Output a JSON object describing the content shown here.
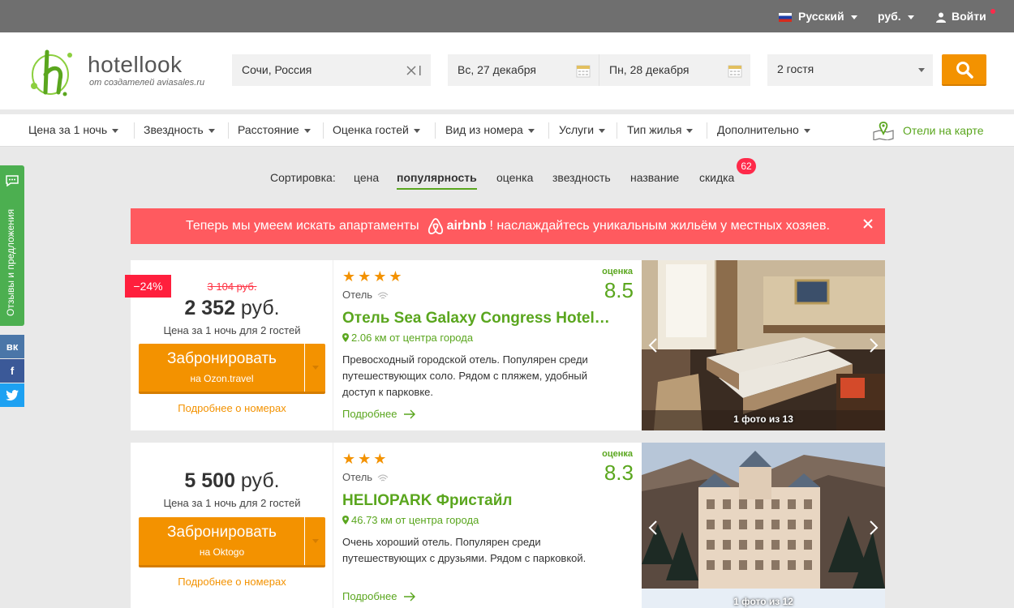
{
  "topbar": {
    "language": "Русский",
    "currency": "руб.",
    "login": "Войти"
  },
  "header": {
    "logo_name": "hotellook",
    "logo_sub": "от создателей aviasales.ru",
    "destination": "Сочи, Россия",
    "checkin": "Вс, 27 декабря",
    "checkout": "Пн, 28 декабря",
    "guests": "2 гостя"
  },
  "filters": [
    "Цена за 1 ночь",
    "Звездность",
    "Расстояние",
    "Оценка гостей",
    "Вид из номера",
    "Услуги",
    "Тип жилья",
    "Дополнительно"
  ],
  "map_link": "Отели на карте",
  "feedback_tab": "Отзывы и предложения",
  "social": [
    "вк",
    "f",
    "tw"
  ],
  "sort": {
    "label": "Сортировка:",
    "options": [
      "цена",
      "популярность",
      "оценка",
      "звездность",
      "название",
      "скидка"
    ],
    "active": "популярность",
    "discount_badge": "62"
  },
  "banner": {
    "text_before": "Теперь мы умеем искать апартаменты",
    "brand": "airbnb",
    "text_after": "! наслаждайтесь уникальным жильём у местных хозяев."
  },
  "hotels": [
    {
      "discount": "−24%",
      "old_price": "3 104 руб.",
      "price": "2 352",
      "currency": "руб.",
      "price_note": "Цена за 1 ночь для 2 гостей",
      "book_label": "Забронировать",
      "book_agent": "на Ozon.travel",
      "more_rooms": "Подробнее о номерах",
      "stars": "★★★★",
      "type": "Отель",
      "rating_label": "оценка",
      "rating": "8.5",
      "name": "Отель Sea Galaxy Congress Hotel а...",
      "distance": "2.06 км от центра города",
      "description": "Превосходный городской отель. Популярен среди путешествующих соло. Рядом с пляжем, удобный доступ к парковке.",
      "details": "Подробнее",
      "photo_caption": "1 фото из 13"
    },
    {
      "discount": "",
      "old_price": "",
      "price": "5 500",
      "currency": "руб.",
      "price_note": "Цена за 1 ночь для 2 гостей",
      "book_label": "Забронировать",
      "book_agent": "на Oktogo",
      "more_rooms": "Подробнее о номерах",
      "stars": "★★★",
      "type": "Отель",
      "rating_label": "оценка",
      "rating": "8.3",
      "name": "HELIOPARK Фристайл",
      "distance": "46.73 км от центра города",
      "description": "Очень хороший отель. Популярен среди путешествующих с друзьями. Рядом с парковкой.",
      "details": "Подробнее",
      "photo_caption": "1 фото из 12"
    }
  ]
}
